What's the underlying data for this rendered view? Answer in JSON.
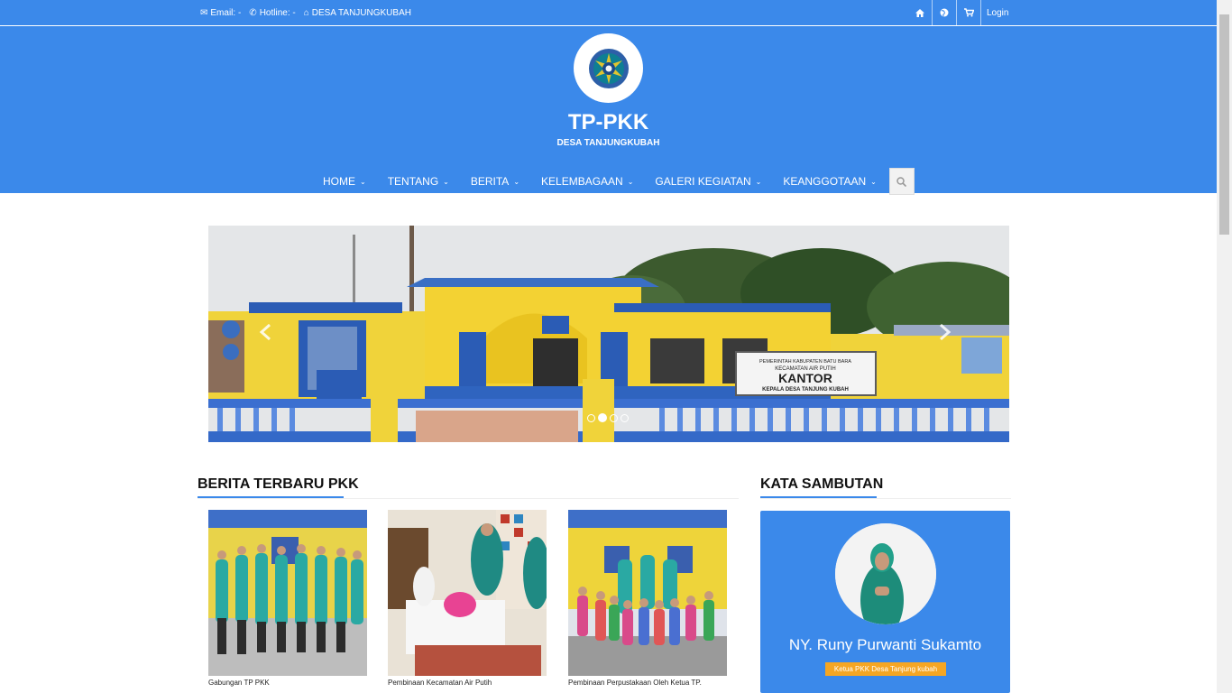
{
  "topbar": {
    "email_label": "Email: -",
    "hotline_label": "Hotline: -",
    "location_label": "DESA TANJUNGKUBAH",
    "login_label": "Login"
  },
  "header": {
    "title": "TP-PKK",
    "subtitle": "DESA TANJUNGKUBAH"
  },
  "nav": {
    "items": [
      {
        "label": "HOME"
      },
      {
        "label": "TENTANG"
      },
      {
        "label": "BERITA"
      },
      {
        "label": "KELEMBAGAAN"
      },
      {
        "label": "GALERI KEGIATAN"
      },
      {
        "label": "KEANGGOTAAN"
      }
    ]
  },
  "slider": {
    "slide_count": 4,
    "active_index": 1,
    "sign_text": [
      "PEMERINTAH KABUPATEN BATU BARA",
      "KECAMATAN AIR PUTIH",
      "KANTOR",
      "KEPALA DESA TANJUNG KUBAH"
    ]
  },
  "news": {
    "heading": "BERITA TERBARU PKK",
    "items": [
      {
        "caption": "Gabungan TP PKK"
      },
      {
        "caption": "Pembinaan Kecamatan Air Putih"
      },
      {
        "caption": "Pembinaan Perpustakaan Oleh Ketua TP."
      }
    ]
  },
  "sambutan": {
    "heading": "KATA SAMBUTAN",
    "name": "NY. Runy Purwanti Sukamto",
    "role": "Ketua PKK Desa Tanjung kubah"
  },
  "colors": {
    "brand_blue": "#3b89ea",
    "accent_orange": "#f5a623"
  }
}
